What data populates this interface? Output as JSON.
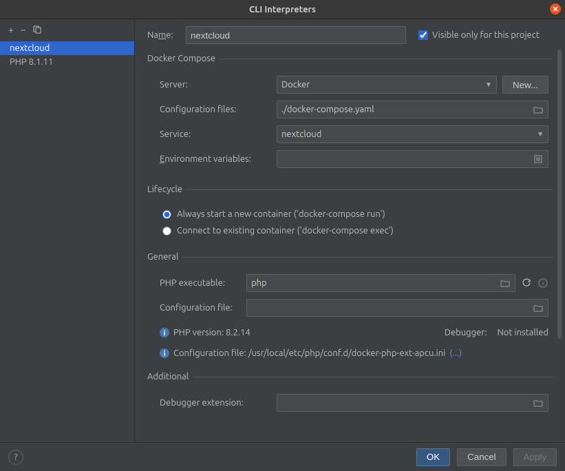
{
  "title": "CLI Interpreters",
  "sidebar": {
    "items": [
      {
        "label": "nextcloud"
      },
      {
        "label": "PHP 8.1.11"
      }
    ]
  },
  "name": {
    "label_pre": "Na",
    "label_u": "m",
    "label_post": "e:",
    "value": "nextcloud",
    "visible_only_label": "Visible only for this project"
  },
  "docker": {
    "legend": "Docker Compose",
    "server_label": "Server:",
    "server_value": "Docker",
    "new_btn": "New...",
    "config_files_label": "Configuration files:",
    "config_files_value": "./docker-compose.yaml",
    "service_label": "Service:",
    "service_value": "nextcloud",
    "env_label_pre": "",
    "env_u": "E",
    "env_label_post": "nvironment variables:",
    "env_value": ""
  },
  "lifecycle": {
    "legend": "Lifecycle",
    "opt1": "Always start a new container ('docker-compose run')",
    "opt2": "Connect to existing container ('docker-compose exec')"
  },
  "general": {
    "legend": "General",
    "php_exe_label": "PHP executable:",
    "php_exe_value": "php",
    "config_file_label": "Configuration file:",
    "config_file_value": "",
    "php_version_label": "PHP version: 8.2.14",
    "debugger_label": "Debugger:",
    "debugger_value": "Not installed",
    "config_info_text": "Configuration file: /usr/local/etc/php/conf.d/docker-php-ext-apcu.ini",
    "config_info_more": "(...)"
  },
  "additional": {
    "legend": "Additional",
    "debugger_ext_label": "Debugger extension:",
    "debugger_ext_value": ""
  },
  "footer": {
    "ok": "OK",
    "cancel": "Cancel",
    "apply": "Apply"
  }
}
